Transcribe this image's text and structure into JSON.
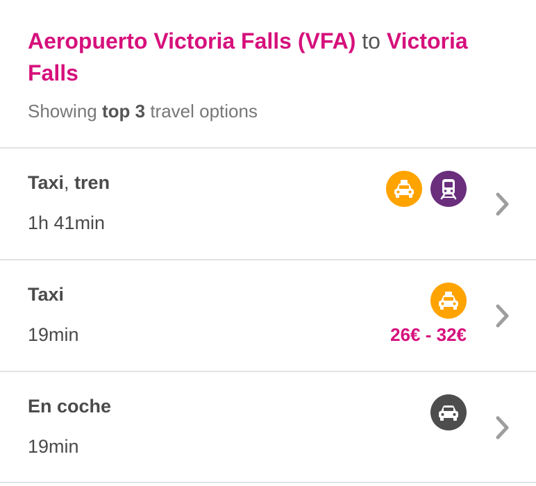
{
  "header": {
    "origin": "Aeropuerto Victoria Falls (VFA)",
    "connector": "to",
    "destination": "Victoria Falls",
    "subtitle_prefix": "Showing",
    "subtitle_highlight": "top 3",
    "subtitle_suffix": "travel options"
  },
  "options": [
    {
      "modes": [
        "Taxi",
        "tren"
      ],
      "separator": ",",
      "duration": "1h 41min",
      "price": "",
      "icons": [
        "taxi-icon",
        "train-icon"
      ]
    },
    {
      "mode": "Taxi",
      "duration": "19min",
      "price": "26€ - 32€",
      "icons": [
        "taxi-icon"
      ]
    },
    {
      "mode": "En coche",
      "duration": "19min",
      "price": "",
      "icons": [
        "car-icon"
      ]
    }
  ],
  "colors": {
    "accent": "#d6107c",
    "taxi": "#ffa300",
    "train": "#6a2e7d",
    "car": "#4d4d4d",
    "chevron": "#9e9e9e"
  }
}
